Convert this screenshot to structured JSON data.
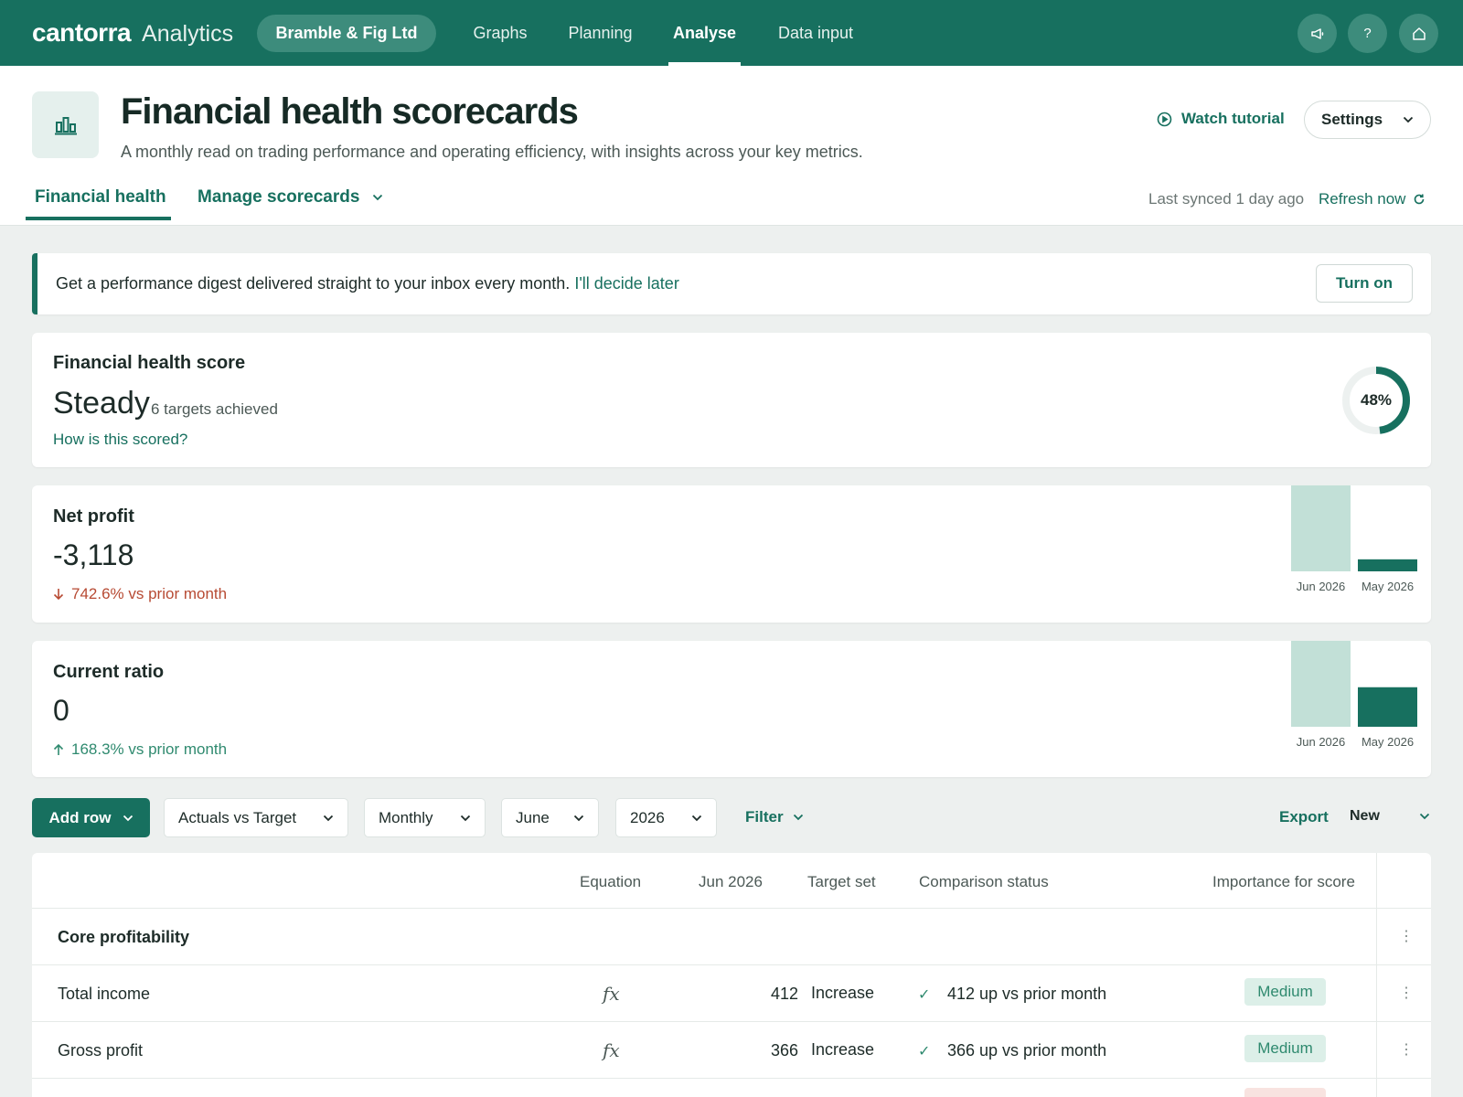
{
  "nav": {
    "brand_name": "cantorra",
    "brand_sub": "Analytics",
    "org": "Bramble & Fig Ltd",
    "items": [
      "Graphs",
      "Planning",
      "Analyse",
      "Data input"
    ],
    "active": "Analyse",
    "icons": [
      "megaphone-icon",
      "help-icon",
      "home-icon"
    ],
    "help_glyph": "?"
  },
  "header": {
    "title": "Financial health scorecards",
    "subtitle": "A monthly read on trading performance and operating efficiency, with insights across your key metrics.",
    "watch_tutorial": "Watch tutorial",
    "settings": "Settings",
    "tabs": [
      "Financial health",
      "Manage scorecards"
    ],
    "last_synced": "Last synced 1 day ago",
    "refresh": "Refresh now"
  },
  "banner": {
    "text": "Get a performance digest delivered straight to your inbox every month.",
    "link": "I'll decide later",
    "button": "Turn on"
  },
  "score": {
    "title": "Financial health score",
    "status": "Steady",
    "targets": "6 targets achieved",
    "link": "How is this scored?",
    "percent_label": "48%",
    "percent": 48
  },
  "metrics": [
    {
      "title": "Net profit",
      "value": "-3,118",
      "change": "742.6% vs prior month",
      "direction": "down",
      "bars": [
        {
          "label": "Jun 2026",
          "relative": 1.0
        },
        {
          "label": "May 2026",
          "relative": 0.14
        }
      ]
    },
    {
      "title": "Current ratio",
      "value": "0",
      "change": "168.3% vs prior month",
      "direction": "up",
      "bars": [
        {
          "label": "Jun 2026",
          "relative": 1.0
        },
        {
          "label": "May 2026",
          "relative": 0.46
        }
      ]
    }
  ],
  "toolbar": {
    "add_row": "Add row",
    "view": "Actuals vs Target",
    "period": "Monthly",
    "month": "June",
    "year": "2026",
    "filter": "Filter",
    "export": "Export",
    "new": "New"
  },
  "table": {
    "headers": [
      "Equation",
      "Jun 2026",
      "Target set",
      "Comparison status",
      "Importance for score"
    ],
    "group": "Core profitability",
    "rows": [
      {
        "name": "Total income",
        "value": "412",
        "target": "Increase",
        "status": "412 up vs prior month",
        "importance": "Medium"
      },
      {
        "name": "Gross profit",
        "value": "366",
        "target": "Increase",
        "status": "366 up vs prior month",
        "importance": "Medium"
      }
    ]
  },
  "colors": {
    "brand": "#17705f",
    "bar_light": "#c2e0d7",
    "negative": "#b74a33",
    "positive": "#2f8a6f"
  }
}
